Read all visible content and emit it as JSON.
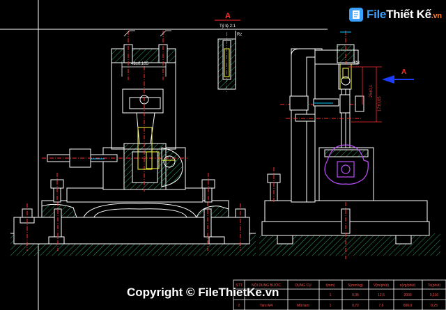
{
  "logo": {
    "part1": "File",
    "part2": "Thiết Kế",
    "part3": ".vn"
  },
  "view_label_top": "A",
  "scale_label": "Tỷ lệ 2:1",
  "view_label_arrow": "A",
  "dimensions": {
    "width_tol": "48±0,105",
    "right_small": "Ø8",
    "right_vertical": "25±0,1",
    "right_vertical2": "17±0,05"
  },
  "table": {
    "headers": [
      "STT",
      "NỘI DUNG BƯỚC",
      "DỤNG CỤ",
      "t(mm)",
      "S(mm/vg)",
      "V(m/phút)",
      "n(vg/phút)",
      "To(phút)"
    ],
    "row1": [
      "1",
      "",
      "",
      "1",
      "0,05",
      "12,5",
      "2000",
      "0,116"
    ],
    "row2": [
      "2",
      "Taro M4",
      "Mũi taro",
      "1",
      "0,72",
      "7,6",
      "600,0",
      "0,25"
    ]
  },
  "copyright": "Copyright © FileThietKe.vn",
  "colors": {
    "background": "#000000",
    "outline": "#ffffff",
    "center_line": "#ff3030",
    "hatch": "#2aa36a",
    "highlight": "#ffff40",
    "dimension": "#ff3030",
    "magenta": "#c050ff",
    "arrow_blue": "#1a3dff",
    "cyan": "#00c8ff"
  }
}
